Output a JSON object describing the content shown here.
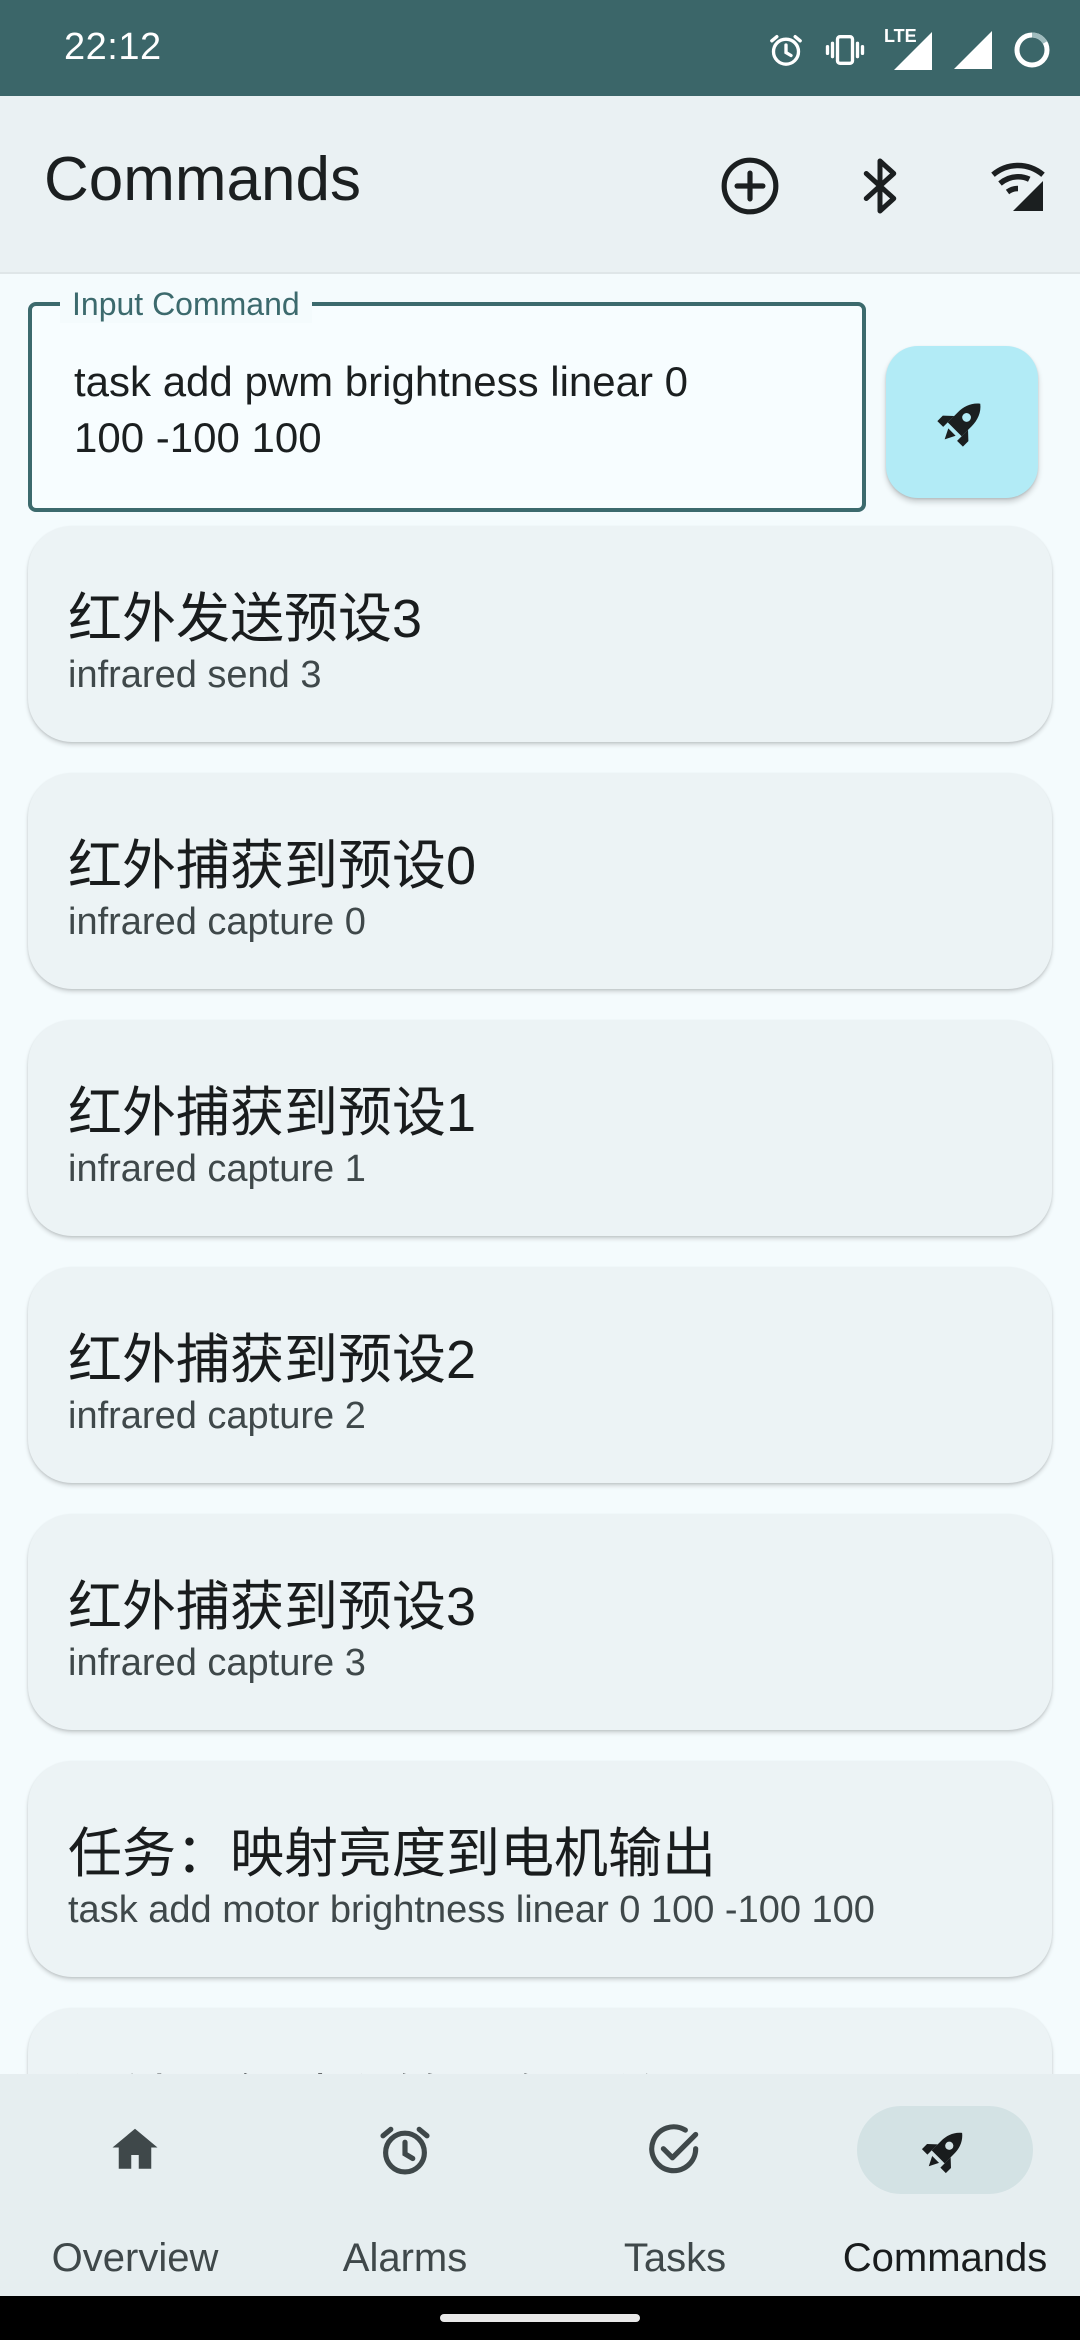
{
  "status_bar": {
    "time": "22:12",
    "network_label": "LTE",
    "icons": [
      "alarm-icon",
      "vibrate-icon",
      "lte-signal-icon",
      "signal-icon",
      "battery-icon"
    ]
  },
  "app_bar": {
    "title": "Commands",
    "actions": [
      "add-circle-icon",
      "bluetooth-icon",
      "wifi-off-icon"
    ]
  },
  "command_input": {
    "label": "Input Command",
    "value": "task add pwm brightness linear 0\n100 -100 100",
    "send_icon": "rocket-icon"
  },
  "commands": [
    {
      "title": "红外发送预设3",
      "command": "infrared send 3"
    },
    {
      "title": "红外捕获到预设0",
      "command": "infrared capture 0"
    },
    {
      "title": "红外捕获到预设1",
      "command": "infrared capture 1"
    },
    {
      "title": "红外捕获到预设2",
      "command": "infrared capture 2"
    },
    {
      "title": "红外捕获到预设3",
      "command": "infrared capture 3"
    },
    {
      "title": "任务：映射亮度到电机输出",
      "command": "task add motor brightness linear 0 100 -100 100"
    },
    {
      "title": "闹钟：每秒翻转一次开关",
      "command": ""
    }
  ],
  "bottom_nav": {
    "selected": "Commands",
    "items": [
      {
        "label": "Overview",
        "icon": "home-icon"
      },
      {
        "label": "Alarms",
        "icon": "alarm-icon"
      },
      {
        "label": "Tasks",
        "icon": "check-circle-icon"
      },
      {
        "label": "Commands",
        "icon": "rocket-icon"
      }
    ]
  },
  "colors": {
    "status_bar": "#3b6669",
    "app_bar": "#eaf1f3",
    "background": "#f4fbfd",
    "card": "#ecf3f5",
    "fab": "#b2ebf6",
    "outline": "#3c6a6d",
    "nav_active_pill": "#d3e2e4"
  }
}
